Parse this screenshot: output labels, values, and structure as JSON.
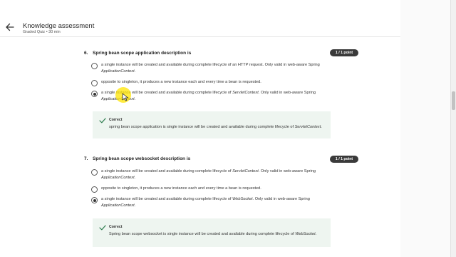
{
  "header": {
    "title": "Knowledge assessment",
    "subtitle": "Graded Quiz • 30 min"
  },
  "questions": [
    {
      "number": "6.",
      "text": "Spring bean scope application description is",
      "points": "1 / 1 point",
      "options": [
        {
          "pre": "a single instance will be created and available during complete lifecycle of an HTTP request. Only valid in web-aware Spring ",
          "em": "ApplicationContext",
          "post": ".",
          "selected": false
        },
        {
          "pre": "opposite to singleton, it produces a new instance each and every time a bean is requested.",
          "em": "",
          "post": "",
          "selected": false
        },
        {
          "pre": "a single instance will be created and available during complete lifecycle of ",
          "em": "ServletContext",
          "post": ". Only valid in web-aware Spring ",
          "em2": "ApplicationContext",
          "post2": ".",
          "selected": true
        }
      ],
      "feedback": {
        "label": "Correct",
        "pre": "spring bean scope application is single instance will be created and available during complete lifecycle of ",
        "em": "ServletContext",
        "post": "."
      }
    },
    {
      "number": "7.",
      "text": "Spring bean scope websocket description is",
      "points": "1 / 1 point",
      "options": [
        {
          "pre": "a single instance will be created and available during complete lifecycle of ",
          "em": "ServletContext",
          "post": ". Only valid in web-aware Spring ",
          "em2": "ApplicationContext",
          "post2": ".",
          "selected": false
        },
        {
          "pre": "opposite to singleton, it produces a new instance each and every time a bean is requested.",
          "em": "",
          "post": "",
          "selected": false
        },
        {
          "pre": "a single instance will be created and available during complete lifecycle of ",
          "em": "WebSocket",
          "post": ". Only valid in web-aware Spring ",
          "em2": "ApplicationContext",
          "post2": ".",
          "selected": true
        }
      ],
      "feedback": {
        "label": "Correct",
        "pre": "Spring bean scope websocket is single instance will be created and available during complete lifecycle of ",
        "em": "WebSocket",
        "post": "."
      }
    }
  ]
}
